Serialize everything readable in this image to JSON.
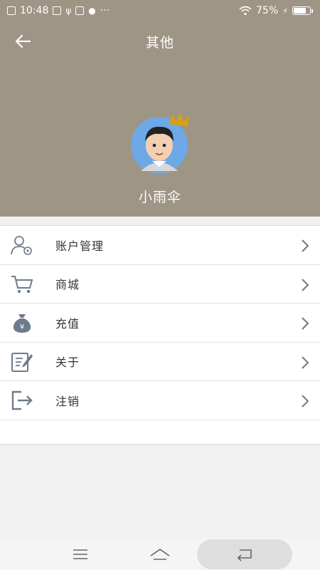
{
  "status_bar": {
    "time": "10:48",
    "battery_percent": "75%",
    "battery_level": 0.75,
    "left_icons": [
      "sim-x-icon",
      "notification-icon",
      "usb-icon",
      "app-icon",
      "wechat-icon"
    ],
    "overflow": "···",
    "right_icons": [
      "wifi-icon",
      "charging-icon",
      "battery-icon"
    ]
  },
  "header": {
    "title": "其他",
    "back_icon": "arrow-left-icon"
  },
  "profile": {
    "username": "小雨伞",
    "avatar_icon": "avatar-boy-with-crown"
  },
  "menu": {
    "items": [
      {
        "label": "账户管理",
        "icon": "account-settings-icon"
      },
      {
        "label": "商城",
        "icon": "cart-icon"
      },
      {
        "label": "充值",
        "icon": "money-bag-icon"
      },
      {
        "label": "关于",
        "icon": "edit-document-icon"
      },
      {
        "label": "注销",
        "icon": "logout-icon"
      }
    ]
  },
  "nav_bar": {
    "icons": [
      "menu-icon",
      "home-icon",
      "back-icon"
    ]
  },
  "colors": {
    "header_bg": "#9e9585",
    "icon_gray": "#6e7b8b",
    "page_bg": "#f1f1f1"
  }
}
